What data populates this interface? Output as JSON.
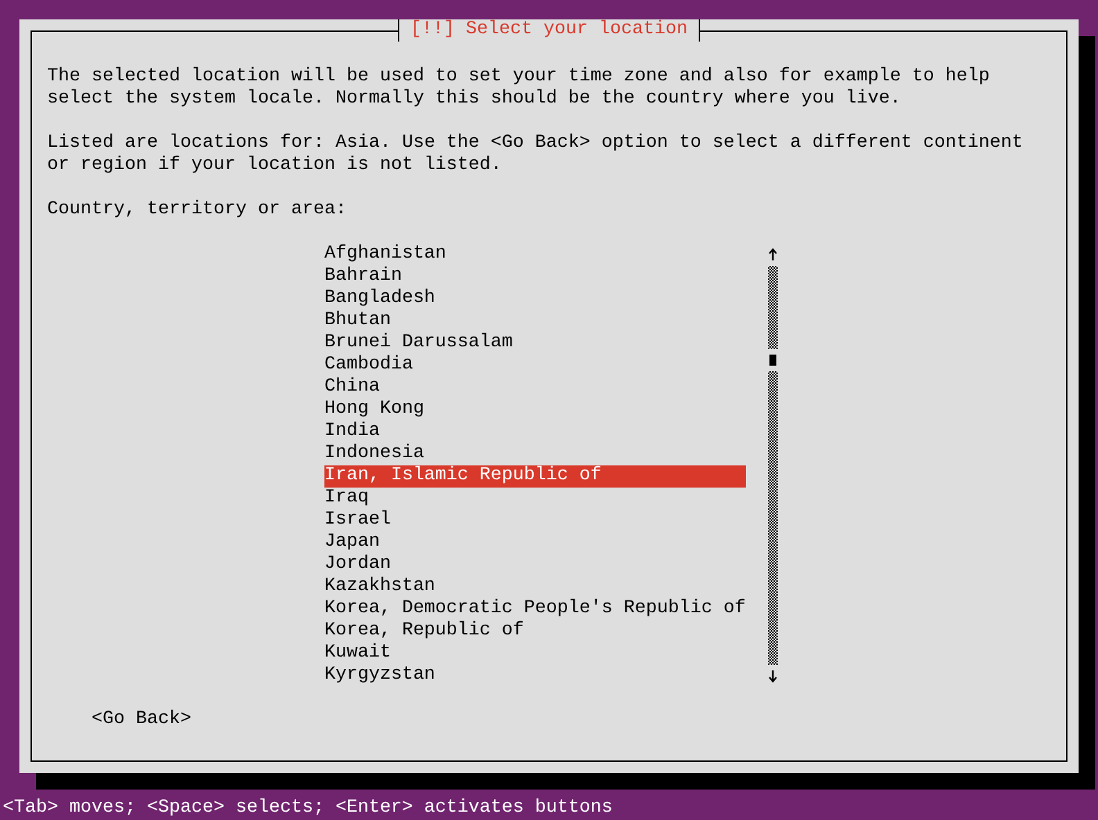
{
  "dialog": {
    "title": "[!!] Select your location",
    "paragraphs": [
      "The selected location will be used to set your time zone and also for example to help select the system locale. Normally this should be the country where you live.",
      "Listed are locations for: Asia. Use the <Go Back> option to select a different continent or region if your location is not listed."
    ],
    "list_label": "Country, territory or area:",
    "countries": [
      {
        "label": "Afghanistan",
        "selected": false
      },
      {
        "label": "Bahrain",
        "selected": false
      },
      {
        "label": "Bangladesh",
        "selected": false
      },
      {
        "label": "Bhutan",
        "selected": false
      },
      {
        "label": "Brunei Darussalam",
        "selected": false
      },
      {
        "label": "Cambodia",
        "selected": false
      },
      {
        "label": "China",
        "selected": false
      },
      {
        "label": "Hong Kong",
        "selected": false
      },
      {
        "label": "India",
        "selected": false
      },
      {
        "label": "Indonesia",
        "selected": false
      },
      {
        "label": "Iran, Islamic Republic of",
        "selected": true
      },
      {
        "label": "Iraq",
        "selected": false
      },
      {
        "label": "Israel",
        "selected": false
      },
      {
        "label": "Japan",
        "selected": false
      },
      {
        "label": "Jordan",
        "selected": false
      },
      {
        "label": "Kazakhstan",
        "selected": false
      },
      {
        "label": "Korea, Democratic People's Republic of",
        "selected": false
      },
      {
        "label": "Korea, Republic of",
        "selected": false
      },
      {
        "label": "Kuwait",
        "selected": false
      },
      {
        "label": "Kyrgyzstan",
        "selected": false
      }
    ],
    "buttons": [
      "<Go Back>"
    ]
  },
  "status_bar": "<Tab> moves; <Space> selects; <Enter> activates buttons"
}
